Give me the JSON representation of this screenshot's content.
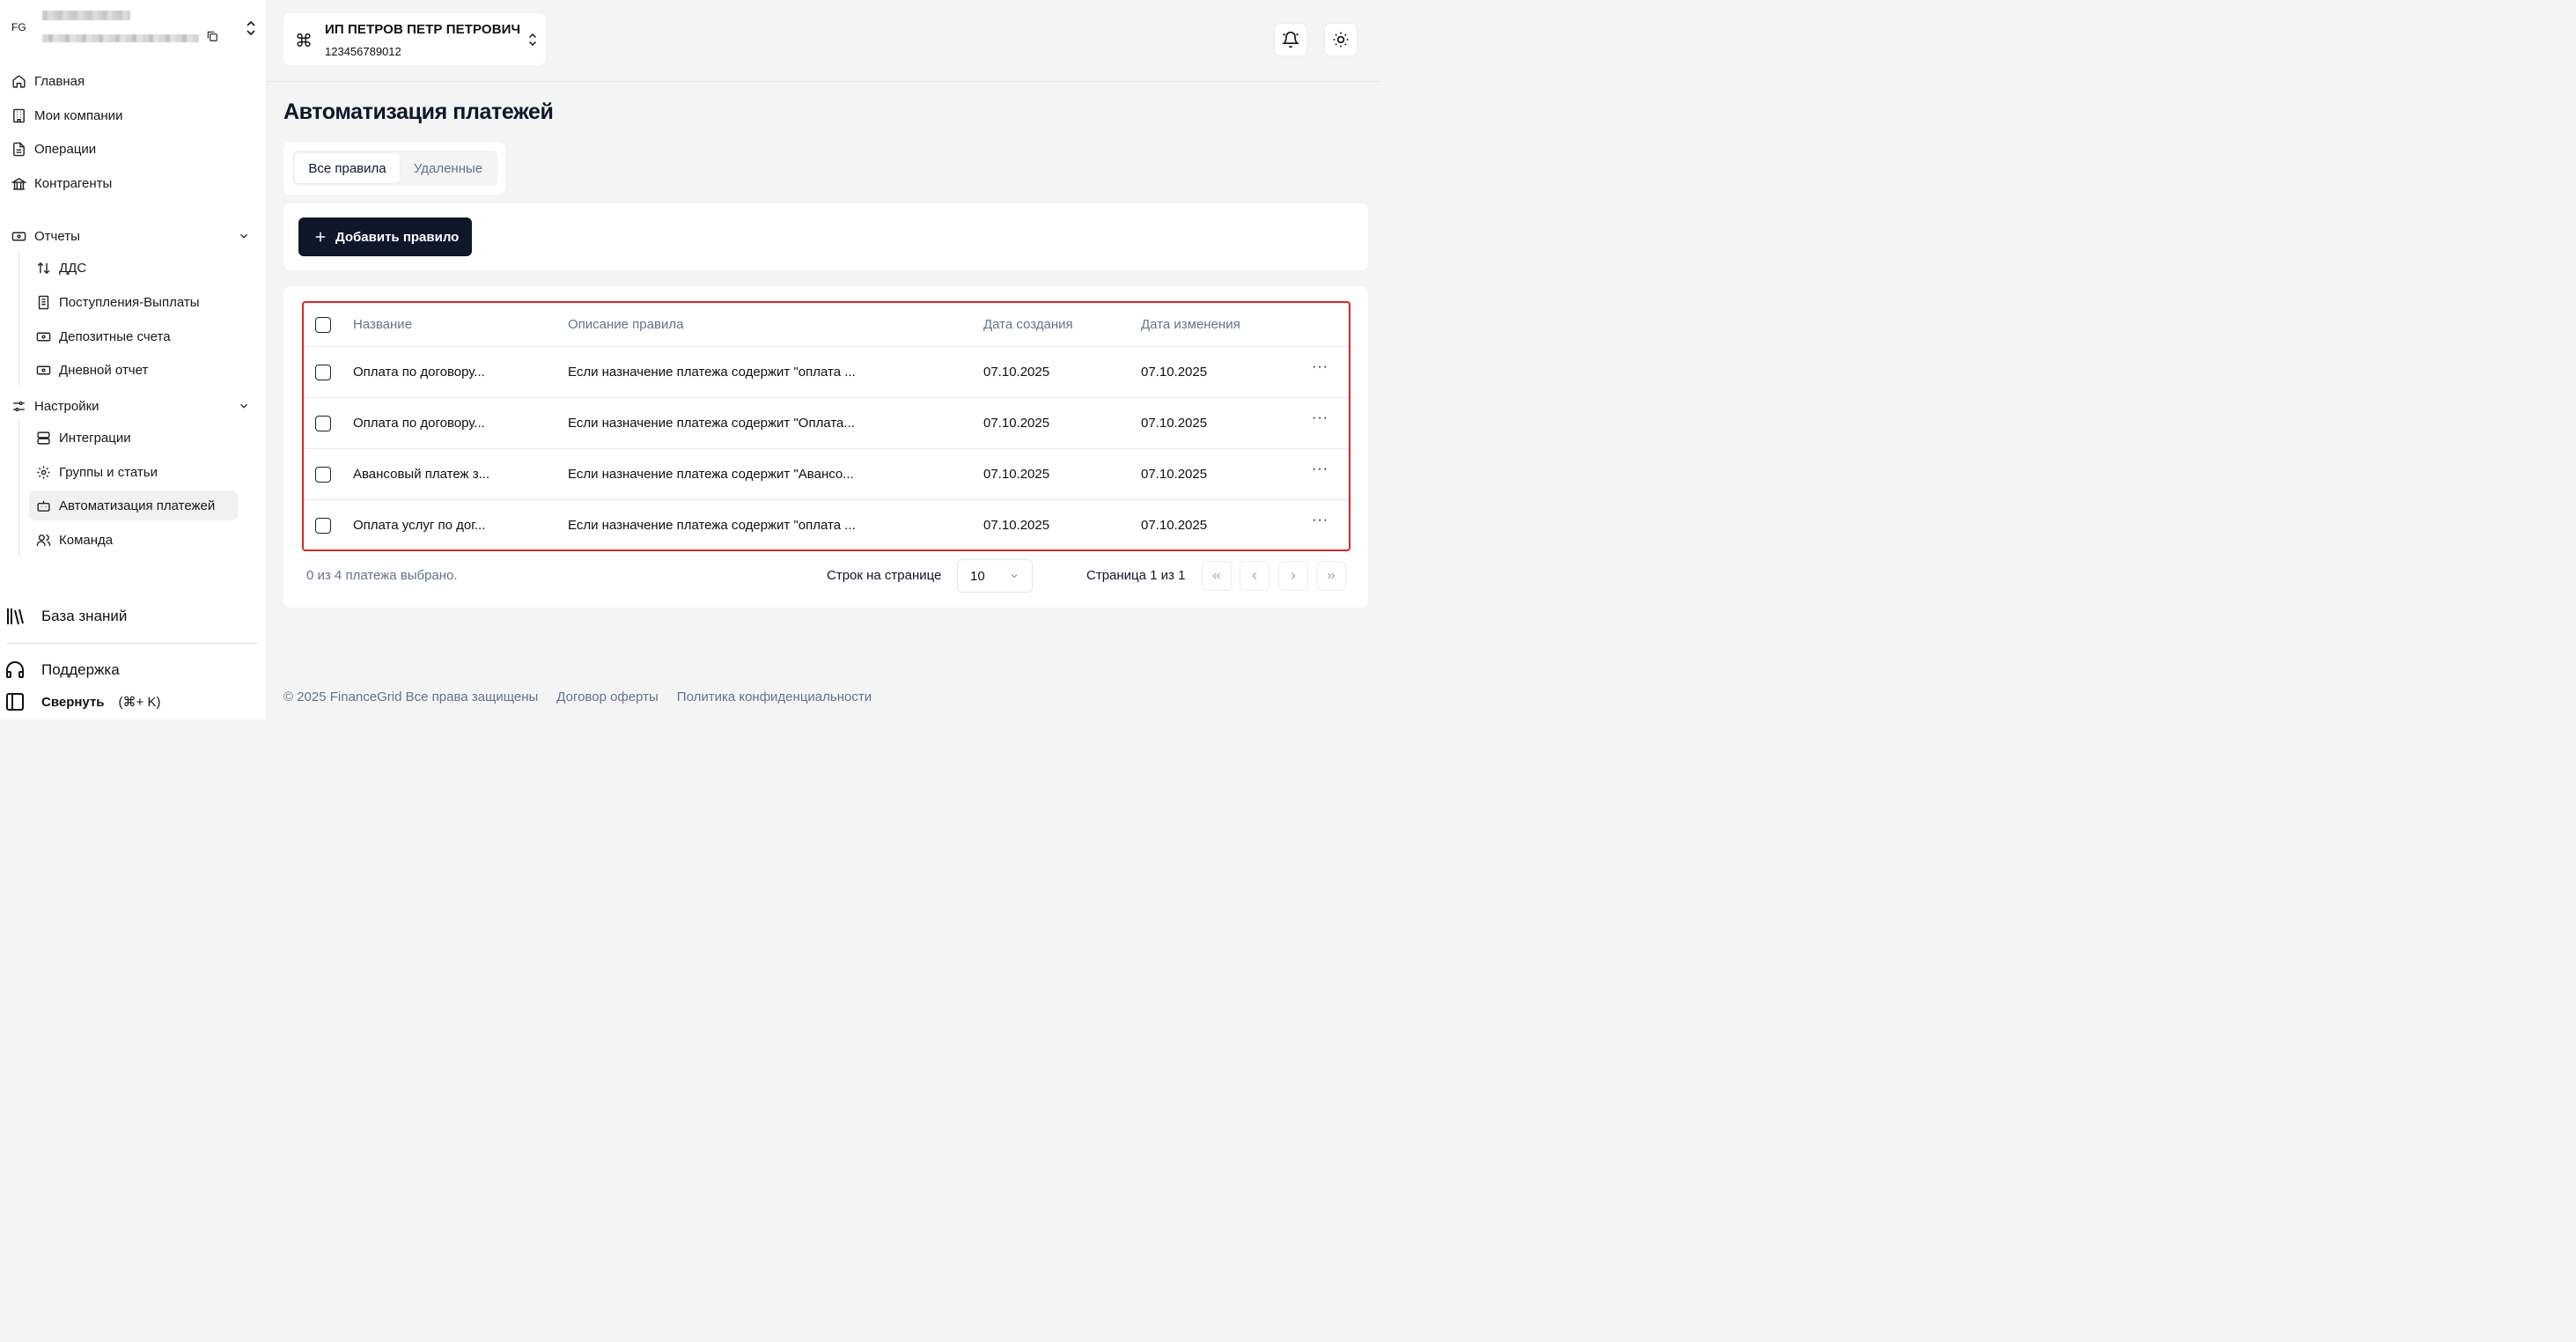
{
  "user": {
    "initials": "FG"
  },
  "sidebar": {
    "main_items": [
      {
        "label": "Главная",
        "icon": "home-icon"
      },
      {
        "label": "Мои компании",
        "icon": "building-icon"
      },
      {
        "label": "Операции",
        "icon": "document-icon"
      },
      {
        "label": "Контрагенты",
        "icon": "bank-icon"
      }
    ],
    "reports": {
      "label": "Отчеты",
      "items": [
        {
          "label": "ДДС",
          "icon": "arrows-updown-icon"
        },
        {
          "label": "Поступления-Выплаты",
          "icon": "receipt-icon"
        },
        {
          "label": "Депозитные счета",
          "icon": "banknote-icon"
        },
        {
          "label": "Дневной отчет",
          "icon": "banknote-icon"
        }
      ]
    },
    "settings": {
      "label": "Настройки",
      "items": [
        {
          "label": "Интеграции",
          "icon": "server-icon"
        },
        {
          "label": "Группы и статьи",
          "icon": "cog-icon"
        },
        {
          "label": "Автоматизация платежей",
          "icon": "bot-icon",
          "active": true
        },
        {
          "label": "Команда",
          "icon": "users-icon"
        }
      ]
    },
    "knowledge_base": "База знаний",
    "support": "Поддержка",
    "collapse": "Свернуть",
    "collapse_shortcut": "(⌘+ K)"
  },
  "company": {
    "name": "ИП ПЕТРОВ ПЕТР ПЕТРОВИЧ",
    "inn": "123456789012"
  },
  "page": {
    "title": "Автоматизация платежей",
    "tabs": [
      "Все правила",
      "Удаленные"
    ],
    "active_tab": "Все правила",
    "add_button": "Добавить правило"
  },
  "table": {
    "columns": [
      "Название",
      "Описание правила",
      "Дата создания",
      "Дата изменения"
    ],
    "rows": [
      {
        "name": "Оплата по договору...",
        "description": "Если назначение платежа содержит \"оплата ...",
        "created": "07.10.2025",
        "modified": "07.10.2025"
      },
      {
        "name": "Оплата по договору...",
        "description": "Если назначение платежа содержит \"Оплата...",
        "created": "07.10.2025",
        "modified": "07.10.2025"
      },
      {
        "name": "Авансовый платеж з...",
        "description": "Если назначение платежа содержит \"Авансо...",
        "created": "07.10.2025",
        "modified": "07.10.2025"
      },
      {
        "name": "Оплата услуг по дог...",
        "description": "Если назначение платежа содержит \"оплата ...",
        "created": "07.10.2025",
        "modified": "07.10.2025"
      }
    ],
    "more_label": "···",
    "selection_info": "0 из 4 платежа выбрано.",
    "rows_per_page_label": "Строк на странице",
    "rows_per_page": "10",
    "page_info": "Страница 1 из 1"
  },
  "footer": {
    "copyright": "© 2025 FinanceGrid Все права защищены",
    "offer": "Договор оферты",
    "privacy": "Политика конфиденциальности"
  },
  "colors": {
    "primary": "#0f172a",
    "highlight_border": "#dc2626",
    "muted_text": "#64748b",
    "background": "#f4f4f5"
  }
}
